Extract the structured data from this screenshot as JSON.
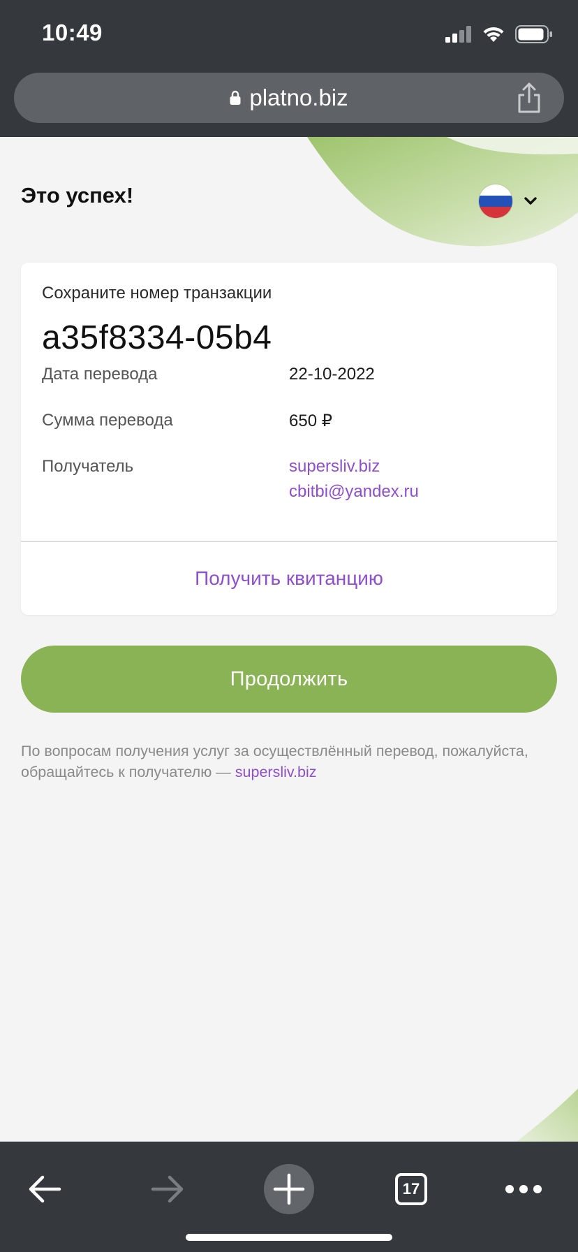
{
  "status_bar": {
    "time": "10:49",
    "icons": [
      "signal-icon",
      "wifi-icon",
      "battery-icon"
    ]
  },
  "browser": {
    "url": "platno.biz",
    "lock_icon": "lock-icon",
    "share_icon": "share-icon"
  },
  "page": {
    "title": "Это успех!",
    "language": {
      "flag": "russia-flag-icon",
      "flag_colors": [
        "#ffffff",
        "#2451b7",
        "#d5343a"
      ],
      "chevron": "chevron-down-icon"
    },
    "card": {
      "save_label": "Сохраните номер транзакции",
      "transaction_id": "a35f8334-05b4",
      "rows": [
        {
          "label": "Дата перевода",
          "value": "22-10-2022"
        },
        {
          "label": "Сумма перевода",
          "value": "650 ₽"
        },
        {
          "label": "Получатель",
          "value": "supersliv.biz",
          "value2": "cbitbi@yandex.ru"
        }
      ],
      "receipt_button": "Получить квитанцию"
    },
    "continue_button": "Продолжить",
    "footnote": {
      "text": "По вопросам получения услуг за осуществлённый перевод, пожалуйста, обращайтесь к получателю — ",
      "link": "supersliv.biz"
    }
  },
  "toolbar": {
    "back_icon": "back-arrow-icon",
    "forward_icon": "forward-arrow-icon",
    "new_tab_icon": "plus-icon",
    "tabs_count": "17",
    "more_icon": "more-dots-icon"
  },
  "colors": {
    "accent_green": "#8ab355",
    "link_purple": "#8e4fcb",
    "chrome_dark": "#35383c"
  }
}
